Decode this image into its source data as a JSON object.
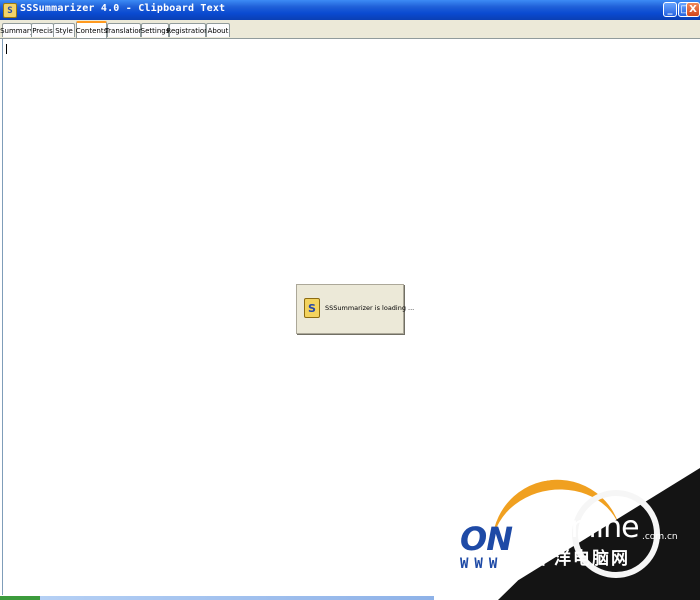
{
  "window": {
    "title": "SSSummarizer 4.0 - Clipboard Text",
    "app_icon_glyph": "S",
    "buttons": {
      "minimize": "_",
      "maximize": "□",
      "close": "X"
    }
  },
  "tabs": [
    {
      "label": "Summary",
      "active": false
    },
    {
      "label": "Precis",
      "active": false
    },
    {
      "label": "Style",
      "active": false
    },
    {
      "label": "Contents",
      "active": true
    },
    {
      "label": "Translation",
      "active": false
    },
    {
      "label": "Settings",
      "active": false
    },
    {
      "label": "Registration",
      "active": false
    },
    {
      "label": "About",
      "active": false
    }
  ],
  "loading": {
    "icon_glyph": "S",
    "message": "SSSummarizer is loading ..."
  },
  "watermark": {
    "left_text": "ON",
    "www": "WWW",
    "brand": "PConline",
    "domain_suffix": ".com.cn",
    "chinese_name": "太平洋电脑网"
  },
  "colors": {
    "titlebar": "#0a4bd2",
    "active_tab_accent": "#ff9a1f",
    "dialog_bg": "#ece9d8"
  }
}
